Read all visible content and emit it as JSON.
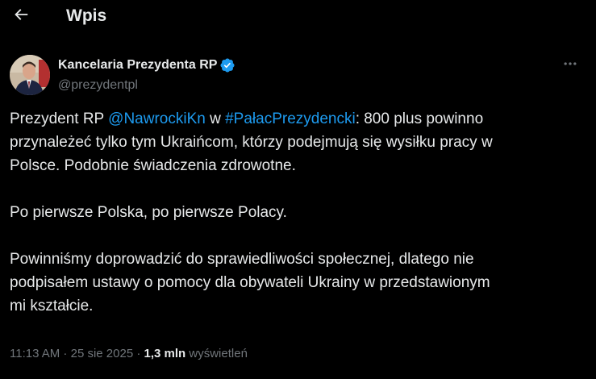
{
  "header": {
    "back_icon": "arrow-left-icon",
    "title": "Wpis"
  },
  "author": {
    "name": "Kancelaria Prezydenta RP",
    "handle": "@prezydentpl",
    "verified_icon": "verified-badge-icon",
    "verified_color": "#1d9bf0"
  },
  "more_icon": "more-horizontal-icon",
  "tweet": {
    "line1_prefix": "Prezydent RP ",
    "mention": "@NawrockiKn",
    "line1_mid": " w ",
    "hashtag": "#PałacPrezydencki",
    "line1_suffix": ": 800 plus powinno",
    "line2": "przynależeć tylko tym Ukraińcom, którzy podejmują się wysiłku pracy w",
    "line3": "Polsce. Podobnie świadczenia zdrowotne.",
    "para2": "Po pierwsze Polska, po pierwsze Polacy.",
    "para3_line1": "Powinniśmy doprowadzić do sprawiedliwości społecznej, dlatego nie",
    "para3_line2": "podpisałem ustawy o pomocy dla obywateli Ukrainy w przedstawionym",
    "para3_line3": "mi kształcie."
  },
  "meta": {
    "time": "11:13 AM",
    "separator": " · ",
    "date": "25 sie 2025",
    "views_count": "1,3 mln",
    "views_label": " wyświetleń"
  },
  "colors": {
    "background": "#000000",
    "text_primary": "#e7e9ea",
    "text_secondary": "#71767b",
    "link": "#1d9bf0"
  }
}
